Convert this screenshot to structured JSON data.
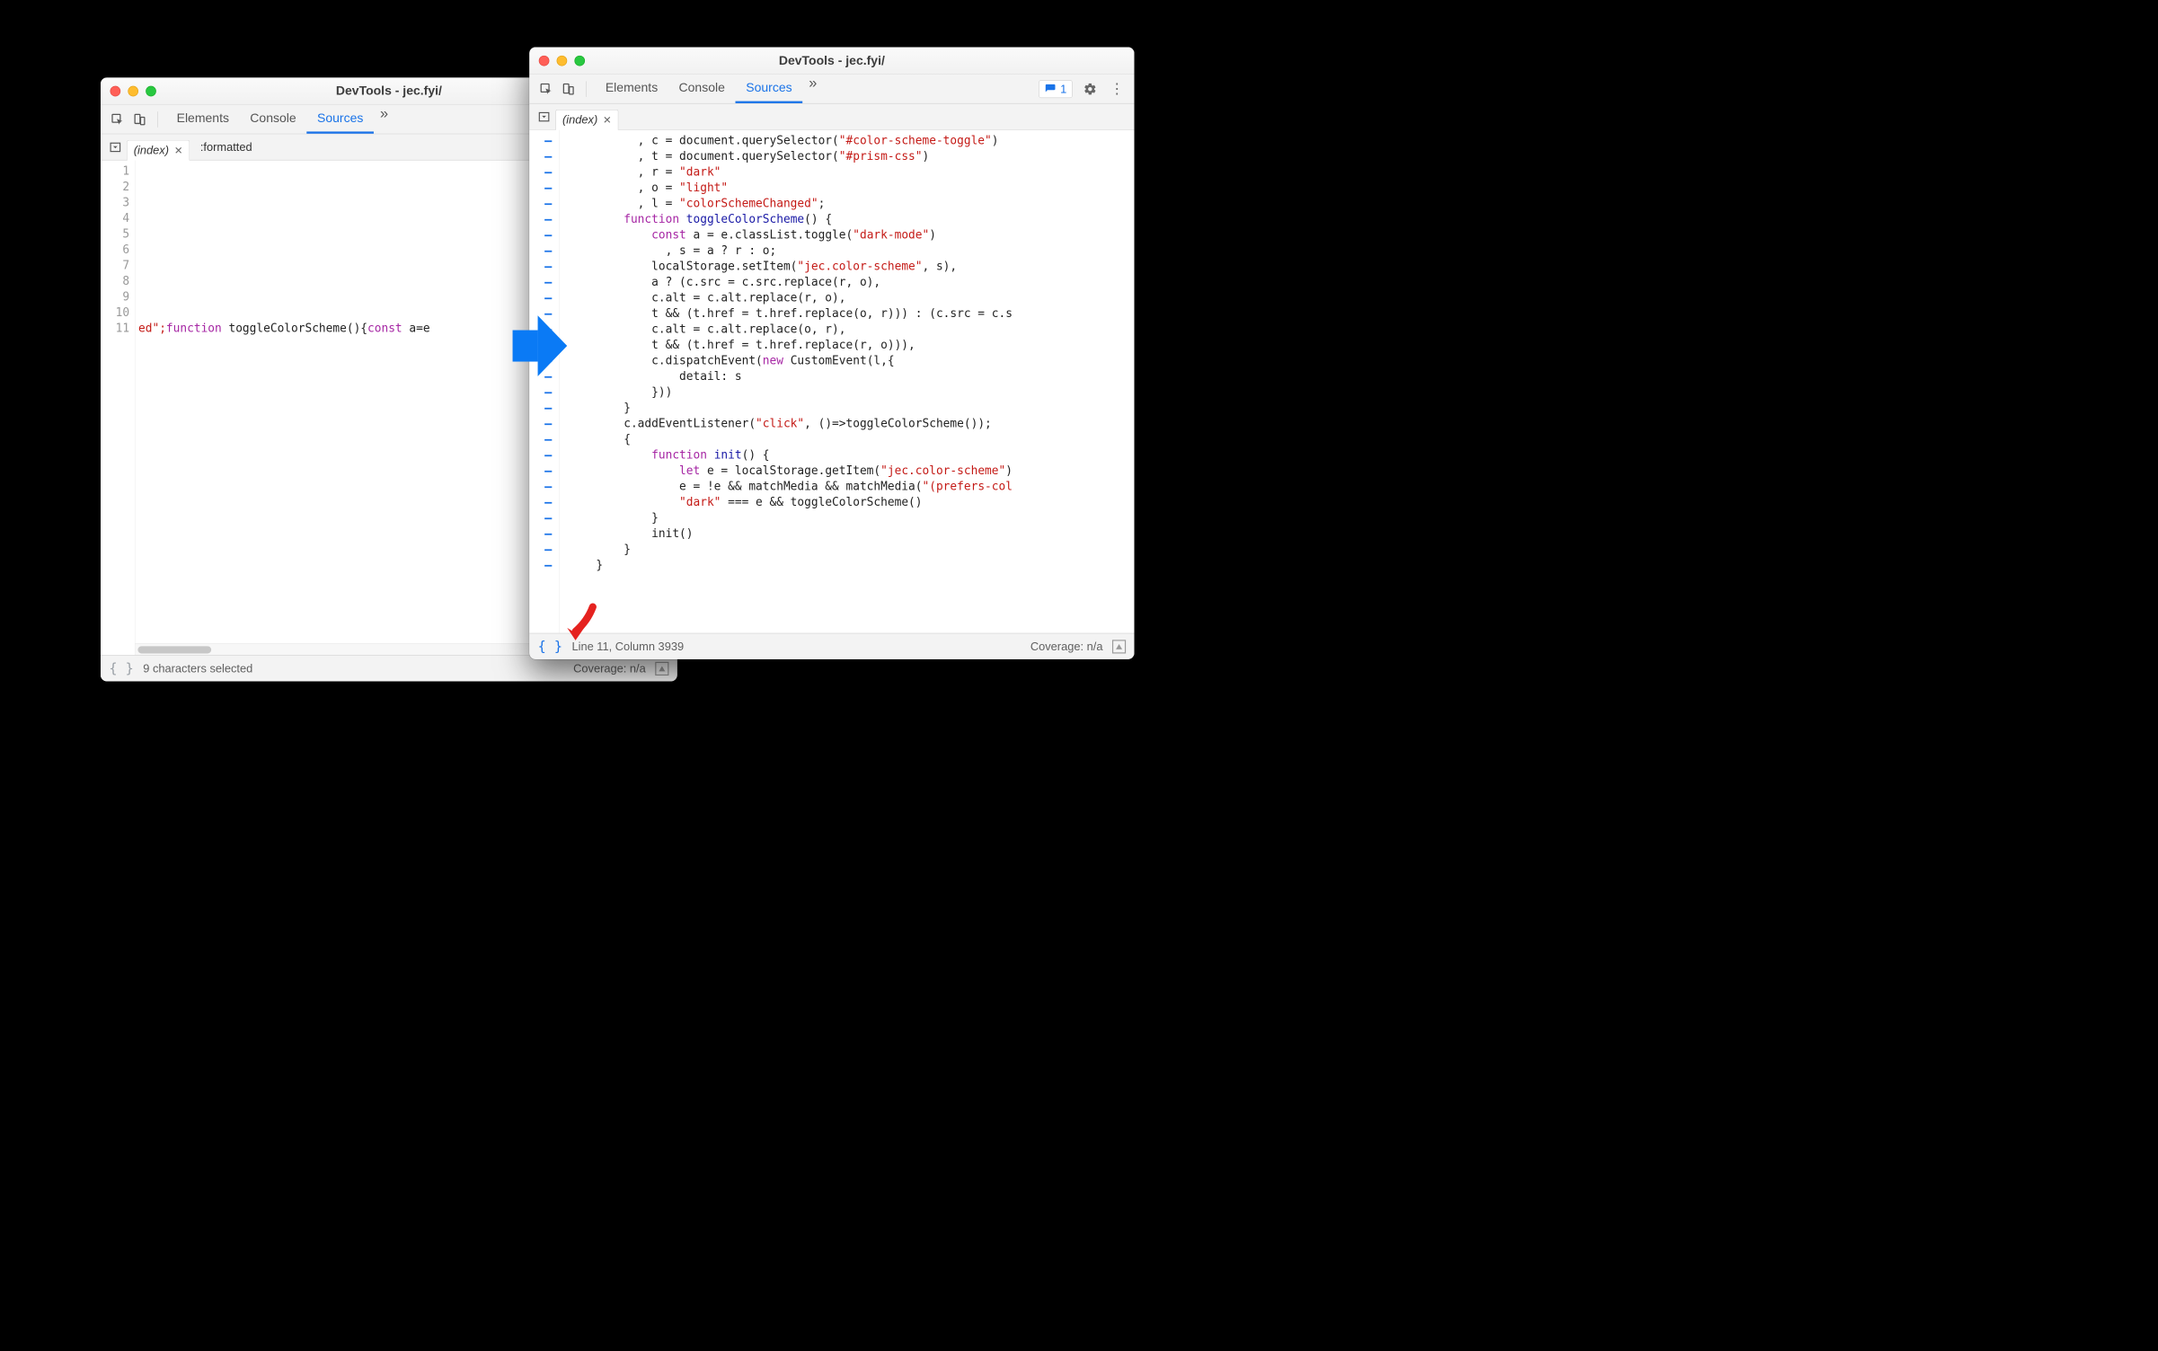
{
  "windowA": {
    "title": "DevTools - jec.fyi/",
    "tabs": {
      "elements": "Elements",
      "console": "Console",
      "sources": "Sources"
    },
    "file_tab": "(index)",
    "extra_tab": ":formatted",
    "line_numbers": [
      "1",
      "2",
      "3",
      "4",
      "5",
      "6",
      "7",
      "8",
      "9",
      "10",
      "11"
    ],
    "code_line11_pre": "ed\";",
    "code_line11_kw1": "function",
    "code_line11_fn": " toggleColorScheme(){",
    "code_line11_kw2": "const",
    "code_line11_tail": " a=e",
    "status_left": "9 characters selected",
    "coverage": "Coverage: n/a"
  },
  "windowB": {
    "title": "DevTools - jec.fyi/",
    "tabs": {
      "elements": "Elements",
      "console": "Console",
      "sources": "Sources"
    },
    "file_tab": "(index)",
    "issues_count": "1",
    "code_lines": [
      "          , c = document.querySelector(<s>\"#color-scheme-toggle\"</s>)",
      "          , t = document.querySelector(<s>\"#prism-css\"</s>)",
      "          , r = <s>\"dark\"</s>",
      "          , o = <s>\"light\"</s>",
      "          , l = <s>\"colorSchemeChanged\"</s>;",
      "        <k>function</k> <f>toggleColorScheme</f>() {",
      "            <k>const</k> a = e.classList.toggle(<s>\"dark-mode\"</s>)",
      "              , s = a ? r : o;",
      "            localStorage.setItem(<s>\"jec.color-scheme\"</s>, s),",
      "            a ? (c.src = c.src.replace(r, o),",
      "            c.alt = c.alt.replace(r, o),",
      "            t && (t.href = t.href.replace(o, r))) : (c.src = c.s",
      "            c.alt = c.alt.replace(o, r),",
      "            t && (t.href = t.href.replace(r, o))),",
      "            c.dispatchEvent(<k>new</k> CustomEvent(l,{",
      "                detail: s",
      "            }))",
      "        }",
      "        c.addEventListener(<s>\"click\"</s>, ()=>toggleColorScheme());",
      "        {",
      "            <k>function</k> <f>init</f>() {",
      "                <k>let</k> e = localStorage.getItem(<s>\"jec.color-scheme\"</s>)",
      "                e = !e && matchMedia && matchMedia(<s>\"(prefers-col</s>",
      "                <s>\"dark\"</s> === e && toggleColorScheme()",
      "            }",
      "            init()",
      "        }",
      "    }"
    ],
    "status_left": "Line 11, Column 3939",
    "coverage": "Coverage: n/a"
  }
}
